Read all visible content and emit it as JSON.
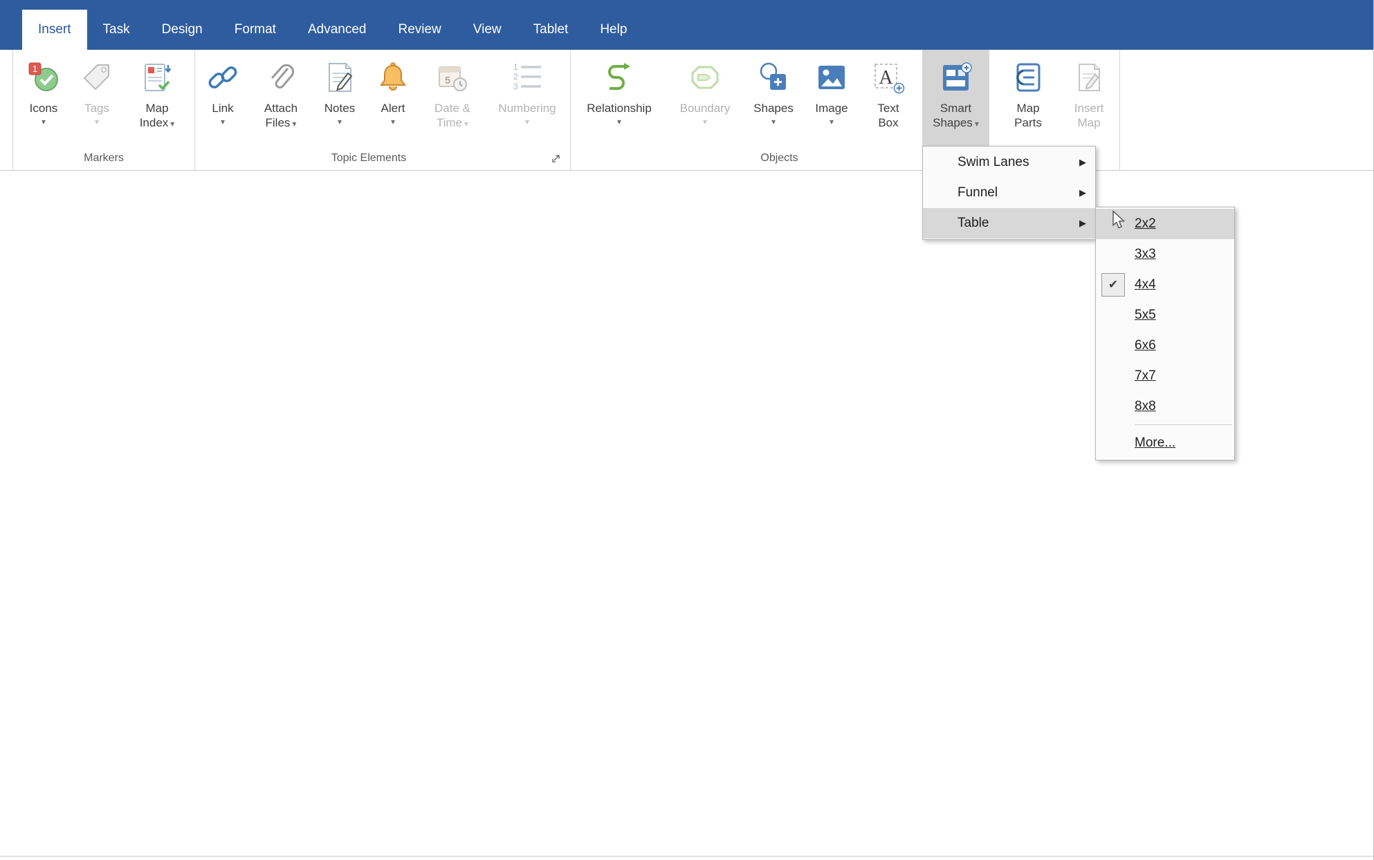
{
  "icons": {
    "chevron_down": "▾",
    "submenu_arrow": "▶",
    "checkmark": "✔"
  },
  "colors": {
    "menubar_blue": "#2E5C9E",
    "active_tab_text": "#2B579A",
    "ribbon_text": "#3F3F3F",
    "disabled_text": "#B3B3B3",
    "group_label_text": "#5A5A5A",
    "menu_highlight": "#D8D8D8",
    "pressed_button_bg": "#D5D5D5",
    "menu_border": "#B6B6B6"
  },
  "menubar": {
    "tabs": [
      "Insert",
      "Task",
      "Design",
      "Format",
      "Advanced",
      "Review",
      "View",
      "Tablet",
      "Help"
    ],
    "active_tab": "Insert"
  },
  "ribbon": {
    "group_labels": {
      "markers": "Markers",
      "topic_elements": "Topic Elements",
      "objects": "Objects"
    },
    "buttons": {
      "icons": "Icons",
      "tags": "Tags",
      "map_index_1": "Map",
      "map_index_2": "Index",
      "link": "Link",
      "attach_files_1": "Attach",
      "attach_files_2": "Files",
      "notes": "Notes",
      "alert": "Alert",
      "date_time_1": "Date &",
      "date_time_2": "Time",
      "numbering": "Numbering",
      "relationship": "Relationship",
      "boundary": "Boundary",
      "shapes": "Shapes",
      "image": "Image",
      "text_box_1": "Text",
      "text_box_2": "Box",
      "smart_shapes_1": "Smart",
      "smart_shapes_2": "Shapes",
      "map_parts_1": "Map",
      "map_parts_2": "Parts",
      "insert_map_1": "Insert",
      "insert_map_2": "Map"
    },
    "disabled_buttons": [
      "Tags",
      "Date & Time",
      "Numbering",
      "Boundary",
      "Insert Map"
    ],
    "pressed_button": "Smart Shapes"
  },
  "smart_shapes_menu": {
    "items": [
      {
        "label": "Swim Lanes"
      },
      {
        "label": "Funnel"
      },
      {
        "label": "Table"
      }
    ],
    "highlighted_item": "Table"
  },
  "table_submenu": {
    "sizes": [
      "2x2",
      "3x3",
      "4x4",
      "5x5",
      "6x6",
      "7x7",
      "8x8"
    ],
    "checked_size": "4x4",
    "highlighted_size": "2x2",
    "more_label": "More..."
  }
}
